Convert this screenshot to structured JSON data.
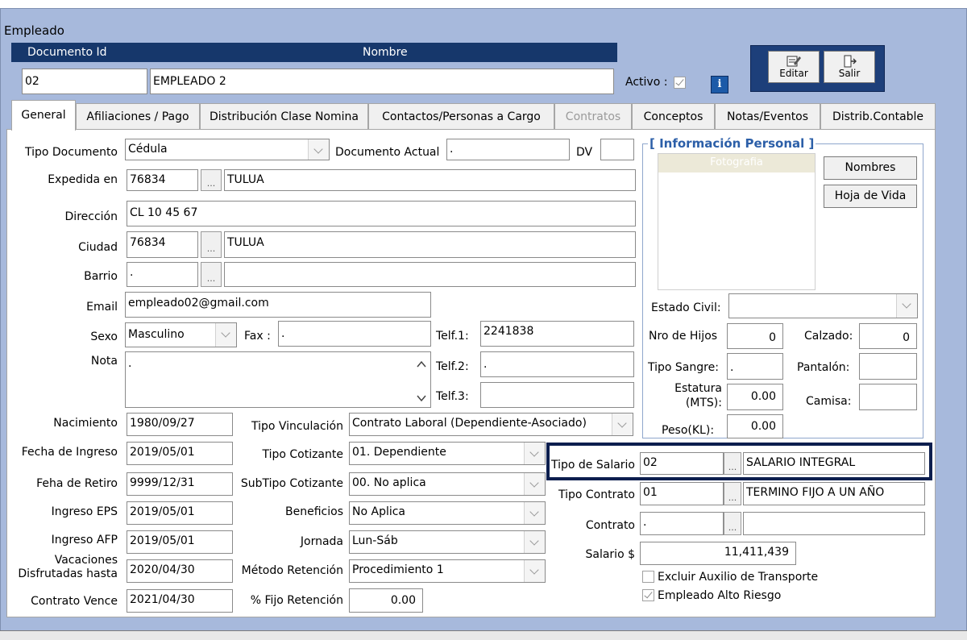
{
  "window": {
    "title": "Empleado"
  },
  "header": {
    "doc_id_label": "Documento Id",
    "nombre_label": "Nombre",
    "doc_id_value": "02",
    "nombre_value": "EMPLEADO 2",
    "activo_label": "Activo :",
    "activo_checked": true,
    "info_label": "i"
  },
  "toolbar": {
    "editar_label": "Editar",
    "salir_label": "Salir"
  },
  "tabs": [
    {
      "label": "General",
      "active": true
    },
    {
      "label": "Afiliaciones / Pago"
    },
    {
      "label": "Distribución Clase Nomina"
    },
    {
      "label": "Contactos/Personas a Cargo"
    },
    {
      "label": "Contratos",
      "disabled": true
    },
    {
      "label": "Conceptos"
    },
    {
      "label": "Notas/Eventos"
    },
    {
      "label": "Distrib.Contable"
    }
  ],
  "general": {
    "tipo_documento": {
      "label": "Tipo Documento",
      "value": "Cédula"
    },
    "documento_actual": {
      "label": "Documento Actual",
      "value": "."
    },
    "dv": {
      "label": "DV",
      "value": ""
    },
    "expedida_en": {
      "label": "Expedida en",
      "code": "76834",
      "name": "TULUA"
    },
    "direccion": {
      "label": "Dirección",
      "value": "CL 10 45 67"
    },
    "ciudad": {
      "label": "Ciudad",
      "code": "76834",
      "name": "TULUA"
    },
    "barrio": {
      "label": "Barrio",
      "code": ".",
      "name": ""
    },
    "email": {
      "label": "Email",
      "value": "empleado02@gmail.com"
    },
    "sexo": {
      "label": "Sexo",
      "value": "Masculino"
    },
    "fax": {
      "label": "Fax :",
      "value": "."
    },
    "telf1": {
      "label": "Telf.1:",
      "value": "2241838"
    },
    "telf2": {
      "label": "Telf.2:",
      "value": "."
    },
    "telf3": {
      "label": "Telf.3:",
      "value": ""
    },
    "nota": {
      "label": "Nota",
      "value": "."
    },
    "nacimiento": {
      "label": "Nacimiento",
      "value": "1980/09/27"
    },
    "fecha_ingreso": {
      "label": "Fecha de Ingreso",
      "value": "2019/05/01"
    },
    "fecha_retiro": {
      "label": "Feha de Retiro",
      "value": "9999/12/31"
    },
    "ingreso_eps": {
      "label": "Ingreso EPS",
      "value": "2019/05/01"
    },
    "ingreso_afp": {
      "label": "Ingreso AFP",
      "value": "2019/05/01"
    },
    "vacaciones": {
      "label_line1": "Vacaciones",
      "label_line2": "Disfrutadas hasta",
      "value": "2020/04/30"
    },
    "contrato_vence": {
      "label": "Contrato Vence",
      "value": "2021/04/30"
    },
    "tipo_vinculacion": {
      "label": "Tipo Vinculación",
      "value": "Contrato Laboral (Dependiente-Asociado)"
    },
    "tipo_cotizante": {
      "label": "Tipo Cotizante",
      "value": "01. Dependiente"
    },
    "subtipo_cotizante": {
      "label": "SubTipo Cotizante",
      "value": "00. No aplica"
    },
    "beneficios": {
      "label": "Beneficios",
      "value": "No Aplica"
    },
    "jornada": {
      "label": "Jornada",
      "value": "Lun-Sáb"
    },
    "metodo_retencion": {
      "label": "Método Retención",
      "value": "Procedimiento 1"
    },
    "fijo_retencion": {
      "label": "% Fijo Retención",
      "value": "0.00"
    }
  },
  "personal": {
    "section_title": "[ Información Personal ]",
    "foto_label": "Fotografia",
    "nombres_button": "Nombres",
    "hoja_vida_button": "Hoja de Vida",
    "estado_civil": {
      "label": "Estado Civil:",
      "value": ""
    },
    "nro_hijos": {
      "label": "Nro de Hijos",
      "value": "0"
    },
    "calzado": {
      "label": "Calzado:",
      "value": "0"
    },
    "tipo_sangre": {
      "label": "Tipo Sangre:",
      "value": "."
    },
    "pantalon": {
      "label": "Pantalón:",
      "value": ""
    },
    "estatura": {
      "label_line1": "Estatura",
      "label_line2": "(MTS):",
      "value": "0.00"
    },
    "camisa": {
      "label": "Camisa:",
      "value": ""
    },
    "peso": {
      "label": "Peso(KL):",
      "value": "0.00"
    }
  },
  "salario": {
    "tipo_salario": {
      "label": "Tipo de Salario",
      "code": "02",
      "name": "SALARIO INTEGRAL"
    },
    "tipo_contrato": {
      "label": "Tipo Contrato",
      "code": "01",
      "name": "TERMINO FIJO A UN AÑO"
    },
    "contrato": {
      "label": "Contrato",
      "code": ".",
      "name": ""
    },
    "salario": {
      "label": "Salario $",
      "value": "11,411,439"
    },
    "excluir_auxilio": {
      "label": "Excluir Auxilio de Transporte",
      "checked": false
    },
    "alto_riesgo": {
      "label": "Empleado Alto Riesgo",
      "checked": true
    }
  },
  "colors": {
    "window_bg": "#a7b9dc",
    "header_bar": "#16376b",
    "highlight_border": "#0c1e4e"
  }
}
